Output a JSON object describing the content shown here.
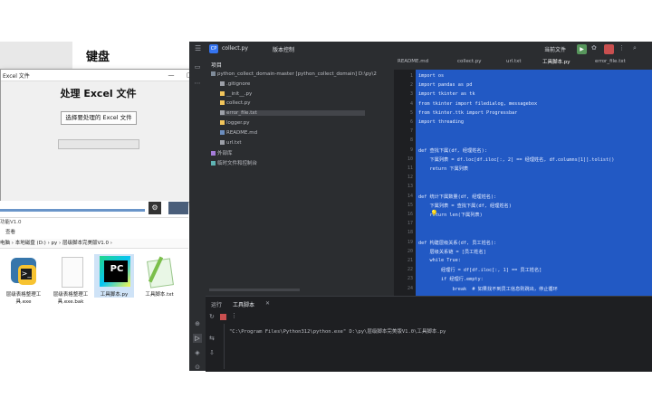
{
  "background": {
    "title": "键盘"
  },
  "tk_window": {
    "title": "Excel 文件",
    "minimize": "—",
    "maximize": "▢",
    "close": "✕",
    "heading": "处理 Excel 文件",
    "select_button": "选择要处理的 Excel 文件"
  },
  "explorer": {
    "folder_label": "功能V1.0",
    "tab_view": "查看",
    "path": "电脑 › 本地磁盘 (D:) › py › 层级脚本完美版V1.0 ›",
    "files": [
      {
        "name": "层级表格整理工具.exe",
        "icon": "app-icon"
      },
      {
        "name": "层级表格整理工具.exe.bak",
        "icon": "file-icon"
      },
      {
        "name": "工具脚本.py",
        "icon": "pycharm-icon"
      },
      {
        "name": "工具脚本.txt",
        "icon": "notepad-icon"
      }
    ]
  },
  "ide": {
    "project_name": "collect.py",
    "branch": "版本控制",
    "run_config": "当前文件",
    "panel_title": "项目",
    "tree": [
      {
        "label": "python_collect_domain-master [python_collect_domain] D:\\py\\2",
        "type": "folder"
      },
      {
        "label": ".gitignore",
        "type": "file"
      },
      {
        "label": "__init__.py",
        "type": "py"
      },
      {
        "label": "collect.py",
        "type": "py"
      },
      {
        "label": "error_file.txt",
        "type": "txt"
      },
      {
        "label": "logger.py",
        "type": "py"
      },
      {
        "label": "README.md",
        "type": "md"
      },
      {
        "label": "url.txt",
        "type": "txt"
      },
      {
        "label": "外部库",
        "type": "lib"
      },
      {
        "label": "临时文件和控制台",
        "type": "scratch"
      }
    ],
    "tabs": [
      "README.md",
      "collect.py",
      "url.txt",
      "工具脚本.py",
      "error_file.txt"
    ],
    "active_tab": "工具脚本.py",
    "code_lines": [
      "import os",
      "import pandas as pd",
      "import tkinter as tk",
      "from tkinter import filedialog, messagebox",
      "from tkinter.ttk import Progressbar",
      "import threading",
      "",
      "",
      "def 查找下属(df, 经理姓名):",
      "    下属列表 = df.loc[df.iloc[:, 2] == 经理姓名, df.columns[1]].tolist()",
      "    return 下属列表",
      "",
      "",
      "def 统计下属数量(df, 经理姓名):",
      "    下属列表 = 查找下属(df, 经理姓名)",
      "    return len(下属列表)",
      "",
      "",
      "def 构建层级关系(df, 员工姓名):",
      "    层级关系链 = [员工姓名]",
      "    while True:",
      "        经理行 = df[df.iloc[:, 1] == 员工姓名]",
      "        if 经理行.empty:",
      "            break  # 如果找不到员工信息则跳出，停止循环"
    ],
    "line_numbers": [
      "1",
      "2",
      "3",
      "4",
      "5",
      "6",
      "7",
      "8",
      "9",
      "10",
      "11",
      "12",
      "13",
      "14",
      "15",
      "16",
      "17",
      "18",
      "19",
      "20",
      "21",
      "22",
      "23",
      "24"
    ],
    "run_panel": {
      "tab_run": "运行",
      "tab_script": "工具脚本",
      "command": "\"C:\\Program Files\\Python312\\python.exe\" D:\\py\\层级脚本完美版V1.0\\工具脚本.py"
    }
  }
}
